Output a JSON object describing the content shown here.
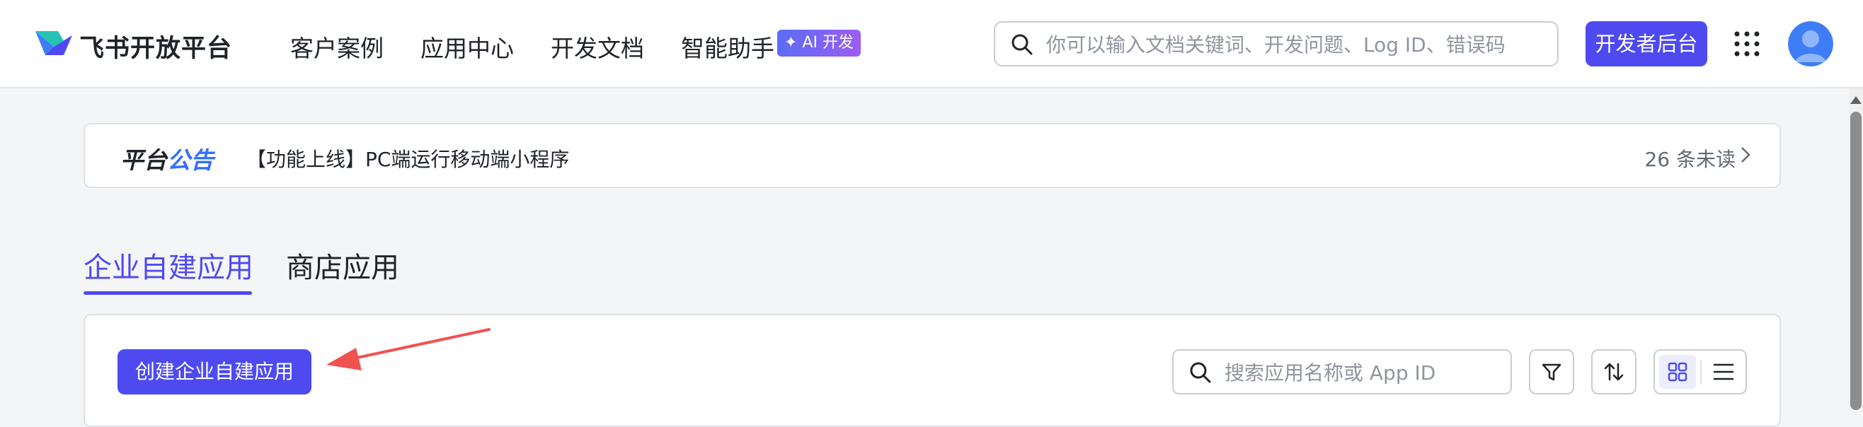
{
  "header": {
    "brand": "飞书开放平台",
    "nav": [
      "客户案例",
      "应用中心",
      "开发文档",
      "智能助手"
    ],
    "ai_badge": "✦ AI 开发",
    "search_placeholder": "你可以输入文档关键词、开发问题、Log ID、错误码",
    "console_button": "开发者后台",
    "accent_color": "#4e4af0"
  },
  "notice": {
    "title_part1": "平台",
    "title_part2": "公告",
    "text": "【功能上线】PC端运行移动端小程序",
    "unread": "26 条未读"
  },
  "tabs": [
    {
      "label": "企业自建应用",
      "active": true
    },
    {
      "label": "商店应用",
      "active": false
    }
  ],
  "toolbar": {
    "create_button": "创建企业自建应用",
    "search_placeholder": "搜索应用名称或 App ID",
    "view_mode": "grid"
  },
  "icons": [
    "search-icon",
    "apps-grid-icon",
    "avatar",
    "chevron-right-icon",
    "filter-icon",
    "sort-icon",
    "grid-view-icon",
    "list-view-icon",
    "annotation-arrow"
  ]
}
